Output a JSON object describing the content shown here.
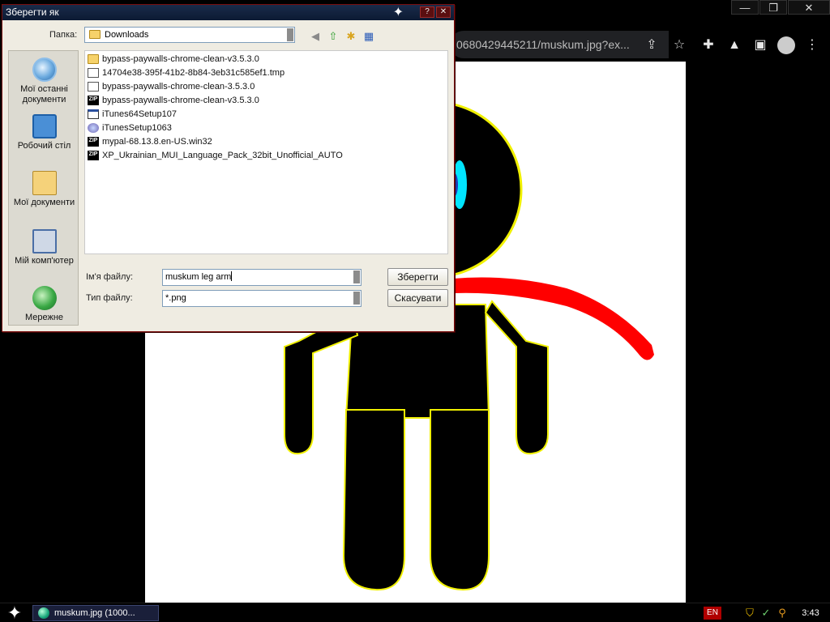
{
  "browser": {
    "url_text": "0680429445211/muskum.jpg?ex...",
    "window_controls": [
      "—",
      "❐",
      "✕"
    ],
    "address_icons": [
      "share-icon",
      "bookmark-star-icon"
    ],
    "toolbar_icons": [
      "extensions-icon",
      "labs-icon",
      "sidebar-icon",
      "profile-icon",
      "menu-icon"
    ]
  },
  "dialog": {
    "title": "Зберегти як",
    "look_in_label": "Папка:",
    "look_in_value": "Downloads",
    "places": [
      {
        "label": "Мої останні документи",
        "icon": "recent-documents-icon"
      },
      {
        "label": "Робочий стіл",
        "icon": "desktop-icon"
      },
      {
        "label": "Мої документи",
        "icon": "my-documents-icon"
      },
      {
        "label": "Мій комп'ютер",
        "icon": "my-computer-icon"
      },
      {
        "label": "Мережне",
        "icon": "network-icon"
      }
    ],
    "files": [
      {
        "name": "bypass-paywalls-chrome-clean-v3.5.3.0",
        "icon": "folder"
      },
      {
        "name": "14704e38-395f-41b2-8b84-3eb31c585ef1.tmp",
        "icon": "tmp"
      },
      {
        "name": "bypass-paywalls-chrome-clean-3.5.3.0",
        "icon": "tmp"
      },
      {
        "name": "bypass-paywalls-chrome-clean-v3.5.3.0",
        "icon": "zip"
      },
      {
        "name": "iTunes64Setup107",
        "icon": "exe"
      },
      {
        "name": "iTunesSetup1063",
        "icon": "itunes"
      },
      {
        "name": "mypal-68.13.8.en-US.win32",
        "icon": "zip"
      },
      {
        "name": "XP_Ukrainian_MUI_Language_Pack_32bit_Unofficial_AUTO",
        "icon": "zip"
      }
    ],
    "file_name_label": "Ім'я файлу:",
    "file_name_value": "muskum leg arm",
    "file_type_label": "Тип файлу:",
    "file_type_value": "*.png",
    "save_button": "Зберегти",
    "cancel_button": "Скасувати"
  },
  "taskbar": {
    "task_label": "muskum.jpg (1000...",
    "language": "EN",
    "clock": "3:43"
  },
  "colors": {
    "canvas_bg": "#ffffff",
    "figure": "#000000",
    "outline": "#f0f000",
    "scarf": "#ff0000",
    "eye": "#00e5ff"
  }
}
